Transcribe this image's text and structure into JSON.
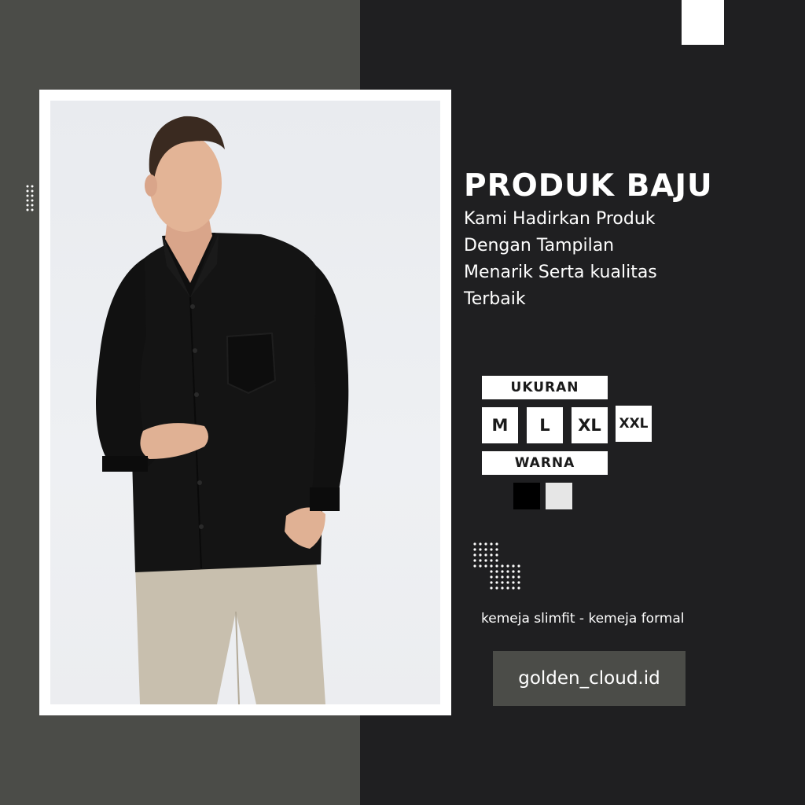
{
  "product": {
    "title": "PRODUK BAJU",
    "subtitle_lines": [
      "Kami Hadirkan Produk",
      "Dengan Tampilan",
      "Menarik Serta kualitas",
      "Terbaik"
    ]
  },
  "sizes": {
    "label": "UKURAN",
    "options": [
      "M",
      "L",
      "XL",
      "XXL"
    ]
  },
  "colors": {
    "label": "WARNA",
    "swatches": [
      {
        "name": "black-swatch",
        "hex": "#000000"
      },
      {
        "name": "light-gray-swatch",
        "hex": "#e6e6e6"
      }
    ]
  },
  "tagline": "kemeja slimfit - kemeja formal",
  "brand": "golden_cloud.id",
  "palette": {
    "left_panel": "#4b4c48",
    "right_panel": "#1f1f21",
    "shirt": "#141414",
    "pants": "#c8bfae"
  }
}
